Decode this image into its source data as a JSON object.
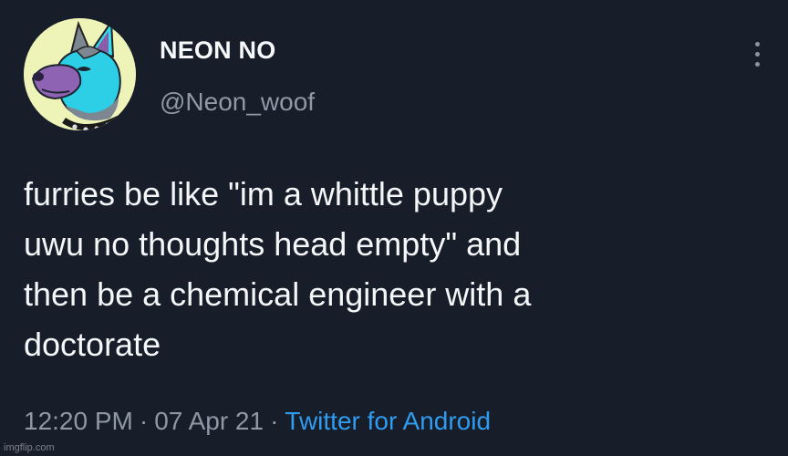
{
  "profile": {
    "display_name": "NEON NO",
    "handle": "@Neon_woof",
    "avatar_icon": "furry-wolf-avatar-icon"
  },
  "menu": {
    "icon": "more-vertical-icon"
  },
  "tweet": {
    "lines": [
      "furries be like \"im a whittle puppy",
      "uwu no thoughts head empty\" and",
      "then be a chemical engineer with a",
      "doctorate"
    ],
    "time": "12:20 PM",
    "separator": "·",
    "date": "07 Apr 21",
    "source": "Twitter for Android"
  },
  "watermark": "imgflip.com",
  "colors": {
    "background": "#171d29",
    "text": "#f4f6f8",
    "muted": "#8e99a5",
    "link": "#2f9cf0"
  }
}
